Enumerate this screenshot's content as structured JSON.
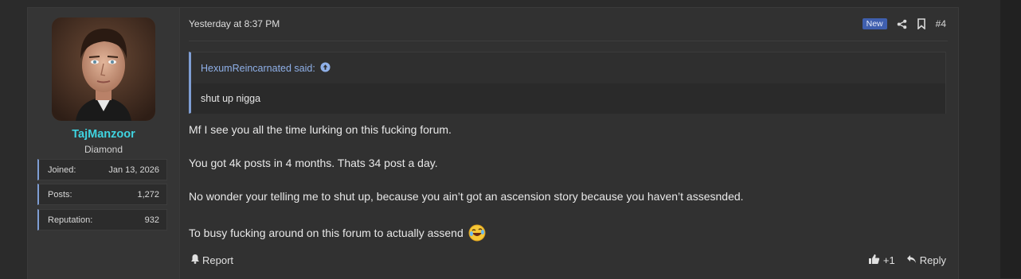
{
  "user": {
    "name": "TajManzoor",
    "title": "Diamond",
    "stats": [
      {
        "label": "Joined:",
        "value": "Jan 13, 2026"
      },
      {
        "label": "Posts:",
        "value": "1,272"
      },
      {
        "label": "Reputation:",
        "value": "932"
      }
    ]
  },
  "post": {
    "date": "Yesterday at 8:37 PM",
    "badge": "New",
    "number": "#4",
    "quote": {
      "author": "HexumReincarnated said:",
      "text": "shut up nigga"
    },
    "paragraphs": [
      "Mf I see you all the time lurking on this fucking forum.",
      "You got 4k posts in 4 months. Thats 34 post a day.",
      "No wonder your telling me to shut up, because you ain’t got an ascension story because you haven’t assesnded.",
      "To busy fucking around on this forum to actually assend"
    ],
    "report_label": "Report",
    "reaction_count": "+1",
    "reply_label": "Reply"
  }
}
